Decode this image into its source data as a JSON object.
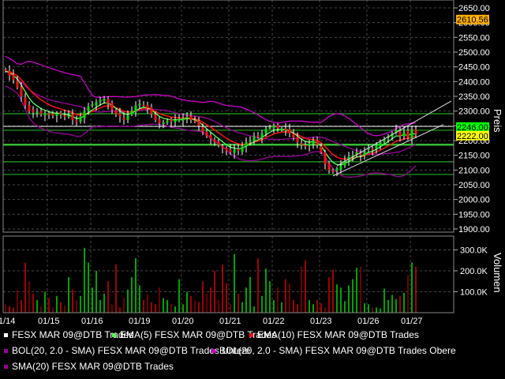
{
  "chart_data": {
    "type": "candlestick",
    "price_panel": {
      "ylabel": "Preis",
      "ylim": [
        1900,
        2650
      ],
      "yticks": [
        "2650.00",
        "2600.00",
        "2550.00",
        "2500.00",
        "2450.00",
        "2400.00",
        "2350.00",
        "2300.00",
        "2250.00",
        "2200.00",
        "2150.00",
        "2100.00",
        "2050.00",
        "2000.00",
        "1950.00",
        "1900.00"
      ],
      "ytick_values": [
        2650,
        2600,
        2550,
        2500,
        2450,
        2400,
        2350,
        2300,
        2250,
        2200,
        2150,
        2100,
        2050,
        2000,
        1950,
        1900
      ],
      "badges": [
        {
          "label": "2610.56",
          "value": 2610.56,
          "color": "#ffb000"
        },
        {
          "label": "2246.00",
          "value": 2246.0,
          "color": "#00ff00"
        },
        {
          "label": "2222.00",
          "value": 2222.0,
          "color": "#ffff00"
        }
      ],
      "horizontal_lines": [
        {
          "value": 2291,
          "color": "#22aa22"
        },
        {
          "value": 2248,
          "color": "#dddddd"
        },
        {
          "value": 2235,
          "color": "#22aa22"
        },
        {
          "value": 2186,
          "color": "#33bb33",
          "thick": true
        },
        {
          "value": 2128,
          "color": "#22aa22"
        },
        {
          "value": 2085,
          "color": "#22aa22"
        }
      ],
      "trendlines": [
        {
          "from": [
            84,
            2114
          ],
          "to": [
            113,
            2334
          ],
          "color": "#dddddd"
        },
        {
          "from": [
            83,
            2080
          ],
          "to": [
            111,
            2254
          ],
          "color": "#dddddd"
        }
      ]
    },
    "volume_panel": {
      "ylabel": "Volumen",
      "ylim": [
        0,
        360
      ],
      "yticks": [
        "300.0K",
        "200.0K",
        "100.0K"
      ],
      "ytick_values": [
        300,
        200,
        100
      ]
    },
    "x_tick_labels": [
      "1/14",
      "01/15",
      "01/16",
      "01/19",
      "01/20",
      "01/21",
      "01/22",
      "01/23",
      "01/26",
      "01/27"
    ],
    "x_tick_index": [
      0,
      11,
      22,
      34,
      45,
      57,
      68,
      80,
      92,
      103
    ],
    "closes": [
      2436,
      2420,
      2405,
      2380,
      2350,
      2320,
      2300,
      2295,
      2298,
      2290,
      2292,
      2288,
      2285,
      2292,
      2290,
      2280,
      2285,
      2270,
      2262,
      2280,
      2300,
      2315,
      2322,
      2330,
      2338,
      2342,
      2325,
      2305,
      2290,
      2282,
      2270,
      2285,
      2300,
      2318,
      2325,
      2320,
      2310,
      2290,
      2270,
      2260,
      2262,
      2268,
      2265,
      2270,
      2272,
      2275,
      2280,
      2270,
      2265,
      2250,
      2230,
      2215,
      2205,
      2195,
      2185,
      2175,
      2165,
      2160,
      2170,
      2165,
      2180,
      2195,
      2200,
      2215,
      2212,
      2225,
      2240,
      2245,
      2250,
      2242,
      2240,
      2235,
      2225,
      2210,
      2195,
      2185,
      2180,
      2190,
      2200,
      2185,
      2160,
      2120,
      2100,
      2095,
      2105,
      2115,
      2130,
      2145,
      2150,
      2160,
      2150,
      2165,
      2175,
      2170,
      2185,
      2195,
      2205,
      2215,
      2225,
      2235,
      2215,
      2230,
      2210,
      2235,
      2222
    ],
    "volumes": [
      40,
      30,
      25,
      110,
      60,
      240,
      150,
      90,
      60,
      30,
      100,
      70,
      25,
      80,
      50,
      35,
      170,
      110,
      60,
      80,
      310,
      240,
      120,
      200,
      60,
      90,
      150,
      40,
      230,
      25,
      70,
      110,
      170,
      260,
      130,
      60,
      90,
      50,
      40,
      120,
      70,
      60,
      40,
      30,
      160,
      40,
      100,
      80,
      60,
      50,
      150,
      90,
      120,
      200,
      60,
      230,
      140,
      40,
      280,
      90,
      50,
      120,
      170,
      30,
      260,
      80,
      210,
      150,
      60,
      120,
      50,
      160,
      140,
      60,
      40,
      220,
      250,
      60,
      40,
      60,
      45,
      25,
      170,
      205,
      135,
      120,
      55,
      130,
      160,
      215,
      220,
      45,
      40,
      25,
      25,
      20,
      115,
      60,
      85,
      65,
      80,
      95,
      180,
      240,
      220,
      55,
      30,
      35,
      35,
      30,
      35
    ],
    "series": [
      {
        "name": "FESX MAR 09@DTB Trades",
        "color": "#ffffff"
      },
      {
        "name": "EMA(5) FESX MAR 09@DTB Trades",
        "color": "#55ff55",
        "period": 5
      },
      {
        "name": "EMA(10) FESX MAR 09@DTB Trades",
        "color": "#ff1010",
        "period": 10
      },
      {
        "name": "BOL(20, 2.0 - SMA) FESX MAR 09@DTB Trades Untere",
        "color": "#990099"
      },
      {
        "name": "BOL(20, 2.0 - SMA) FESX MAR 09@DTB Trades Obere",
        "color": "#cc00cc"
      },
      {
        "name": "SMA(20) FESX MAR 09@DTB Trades",
        "color": "#990099"
      }
    ]
  }
}
